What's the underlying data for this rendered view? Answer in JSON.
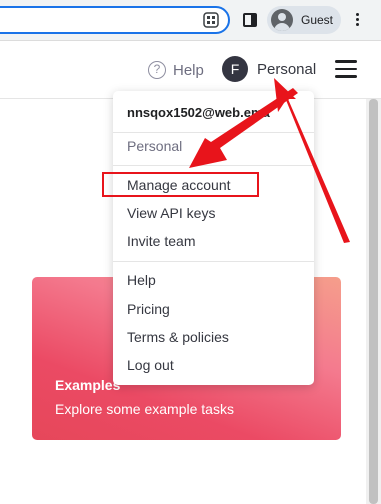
{
  "browser": {
    "profile_label": "Guest",
    "icons": {
      "qr": "qr-code-icon",
      "side_panel": "side-panel-icon",
      "avatar": "person-icon",
      "menu": "more-vert-icon"
    }
  },
  "header": {
    "help_label": "Help",
    "help_icon_glyph": "?",
    "avatar_letter": "F",
    "account_label": "Personal"
  },
  "dropdown": {
    "email": "nnsqox1502@web.ema",
    "org": "Personal",
    "group1": [
      "Manage account",
      "View API keys",
      "Invite team"
    ],
    "group2": [
      "Help",
      "Pricing",
      "Terms & policies",
      "Log out"
    ]
  },
  "card": {
    "title": "Examples",
    "description": "Explore some example tasks",
    "colors": [
      "#f59e8b",
      "#eb4a64"
    ]
  },
  "annotation": {
    "color": "#e8141b"
  }
}
